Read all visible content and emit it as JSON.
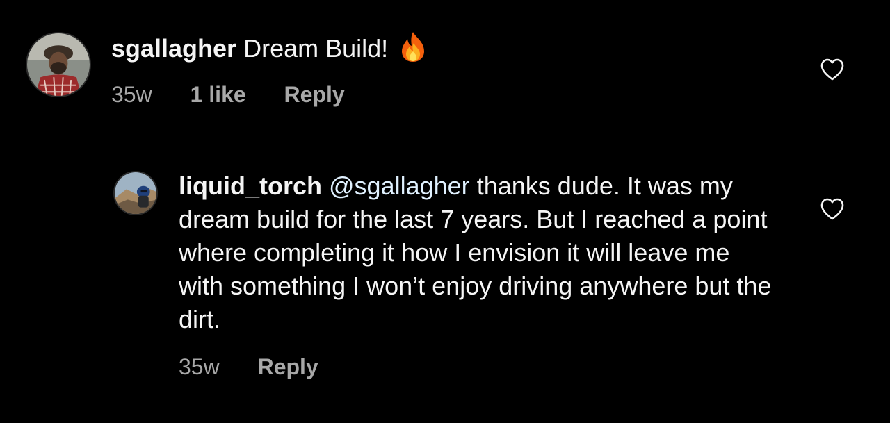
{
  "comments": [
    {
      "username": "sgallagher",
      "text": "Dream Build!",
      "emoji": "fire-emoji",
      "time": "35w",
      "likes": "1 like",
      "reply_label": "Reply",
      "avatar_icon": "user-avatar"
    },
    {
      "username": "liquid_torch",
      "mention": "@sgallagher",
      "text": "thanks dude. It was my dream build for the last 7 years. But I reached a point where completing it how I envision it will leave me with something I won’t enjoy driving anywhere but the dirt.",
      "time": "35w",
      "reply_label": "Reply",
      "avatar_icon": "user-avatar"
    }
  ],
  "icons": {
    "like": "heart-outline-icon"
  },
  "colors": {
    "background": "#000000",
    "primary_text": "#f5f5f5",
    "secondary_text": "#a8a8a8",
    "mention": "#e0f1ff"
  }
}
